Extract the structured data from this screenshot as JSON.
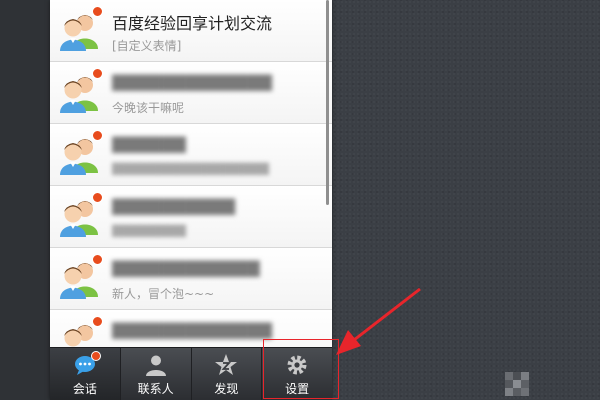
{
  "conversations": [
    {
      "title": "百度经验回享计划交流",
      "subtitle": "[自定义表情]",
      "title_hidden": false,
      "subtitle_hidden": false
    },
    {
      "title": "",
      "subtitle": "今晚该干嘛呢",
      "title_hidden": true,
      "subtitle_hidden": false
    },
    {
      "title": "",
      "subtitle": "",
      "title_hidden": true,
      "subtitle_hidden": true
    },
    {
      "title": "",
      "subtitle": "",
      "title_hidden": true,
      "subtitle_hidden": true
    },
    {
      "title": "",
      "subtitle": "新人，冒个泡~~~",
      "title_hidden": true,
      "subtitle_hidden": false
    },
    {
      "title": "",
      "subtitle": "",
      "title_hidden": true,
      "subtitle_hidden": true
    }
  ],
  "tabbar": {
    "tabs": [
      {
        "label": "会话",
        "icon": "chat-bubble-icon",
        "active": true,
        "badge": true
      },
      {
        "label": "联系人",
        "icon": "contact-person-icon",
        "active": false,
        "badge": false
      },
      {
        "label": "发现",
        "icon": "discover-star-icon",
        "active": false,
        "badge": false
      },
      {
        "label": "设置",
        "icon": "gear-icon",
        "active": false,
        "badge": false
      }
    ]
  },
  "colors": {
    "badge": "#e84c1d",
    "annotation": "#e8252b",
    "tabbar": "#3a3c40",
    "background": "#3b3f45"
  }
}
